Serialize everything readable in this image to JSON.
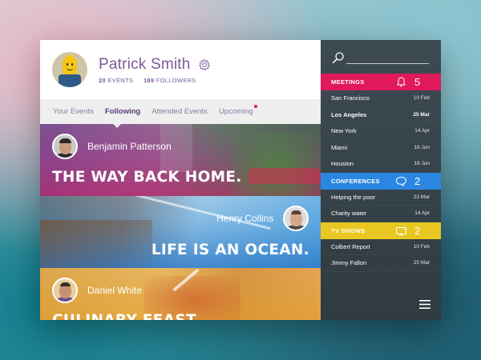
{
  "profile": {
    "name": "Patrick Smith",
    "events_count": "20",
    "events_label": "EVENTS",
    "followers_count": "189",
    "followers_label": "FOLLOWERS"
  },
  "tabs": [
    {
      "label": "Your Events",
      "active": false
    },
    {
      "label": "Following",
      "active": true
    },
    {
      "label": "Attended Events",
      "active": false
    },
    {
      "label": "Upcoming",
      "active": false,
      "has_notification_dot": true
    }
  ],
  "feed": [
    {
      "person": "Benjamin Patterson",
      "title": "THE WAY BACK HOME."
    },
    {
      "person": "Henry Collins",
      "title": "LIFE IS AN OCEAN."
    },
    {
      "person": "Daniel White",
      "title": "CULINARY FEAST"
    }
  ],
  "sidebar": {
    "sections": [
      {
        "title": "MEETINGS",
        "count": "5",
        "color": "#e0195c",
        "icon": "bell-icon",
        "items": [
          {
            "label": "San Francisco",
            "date": "10 Feb",
            "bold": false
          },
          {
            "label": "Los Angeles",
            "date": "25 Mar",
            "bold": true
          },
          {
            "label": "New York",
            "date": "14 Apr",
            "bold": false
          },
          {
            "label": "Miami",
            "date": "16 Jun",
            "bold": false
          },
          {
            "label": "Houston",
            "date": "16 Jun",
            "bold": false
          }
        ]
      },
      {
        "title": "CONFERENCES",
        "count": "2",
        "color": "#2a86e0",
        "icon": "speech-bubble-icon",
        "items": [
          {
            "label": "Helping the poor",
            "date": "23 Mar",
            "bold": false
          },
          {
            "label": "Charity water",
            "date": "14 Apr",
            "bold": false
          }
        ]
      },
      {
        "title": "TV SHOWS",
        "count": "2",
        "color": "#e8c820",
        "icon": "tv-icon",
        "items": [
          {
            "label": "Colbert Report",
            "date": "10 Feb",
            "bold": false
          },
          {
            "label": "Jimmy Fallon",
            "date": "25 Mar",
            "bold": false
          }
        ]
      }
    ]
  },
  "colors": {
    "accent_purple": "#7a5b9a",
    "notification_dot": "#e0195c"
  }
}
